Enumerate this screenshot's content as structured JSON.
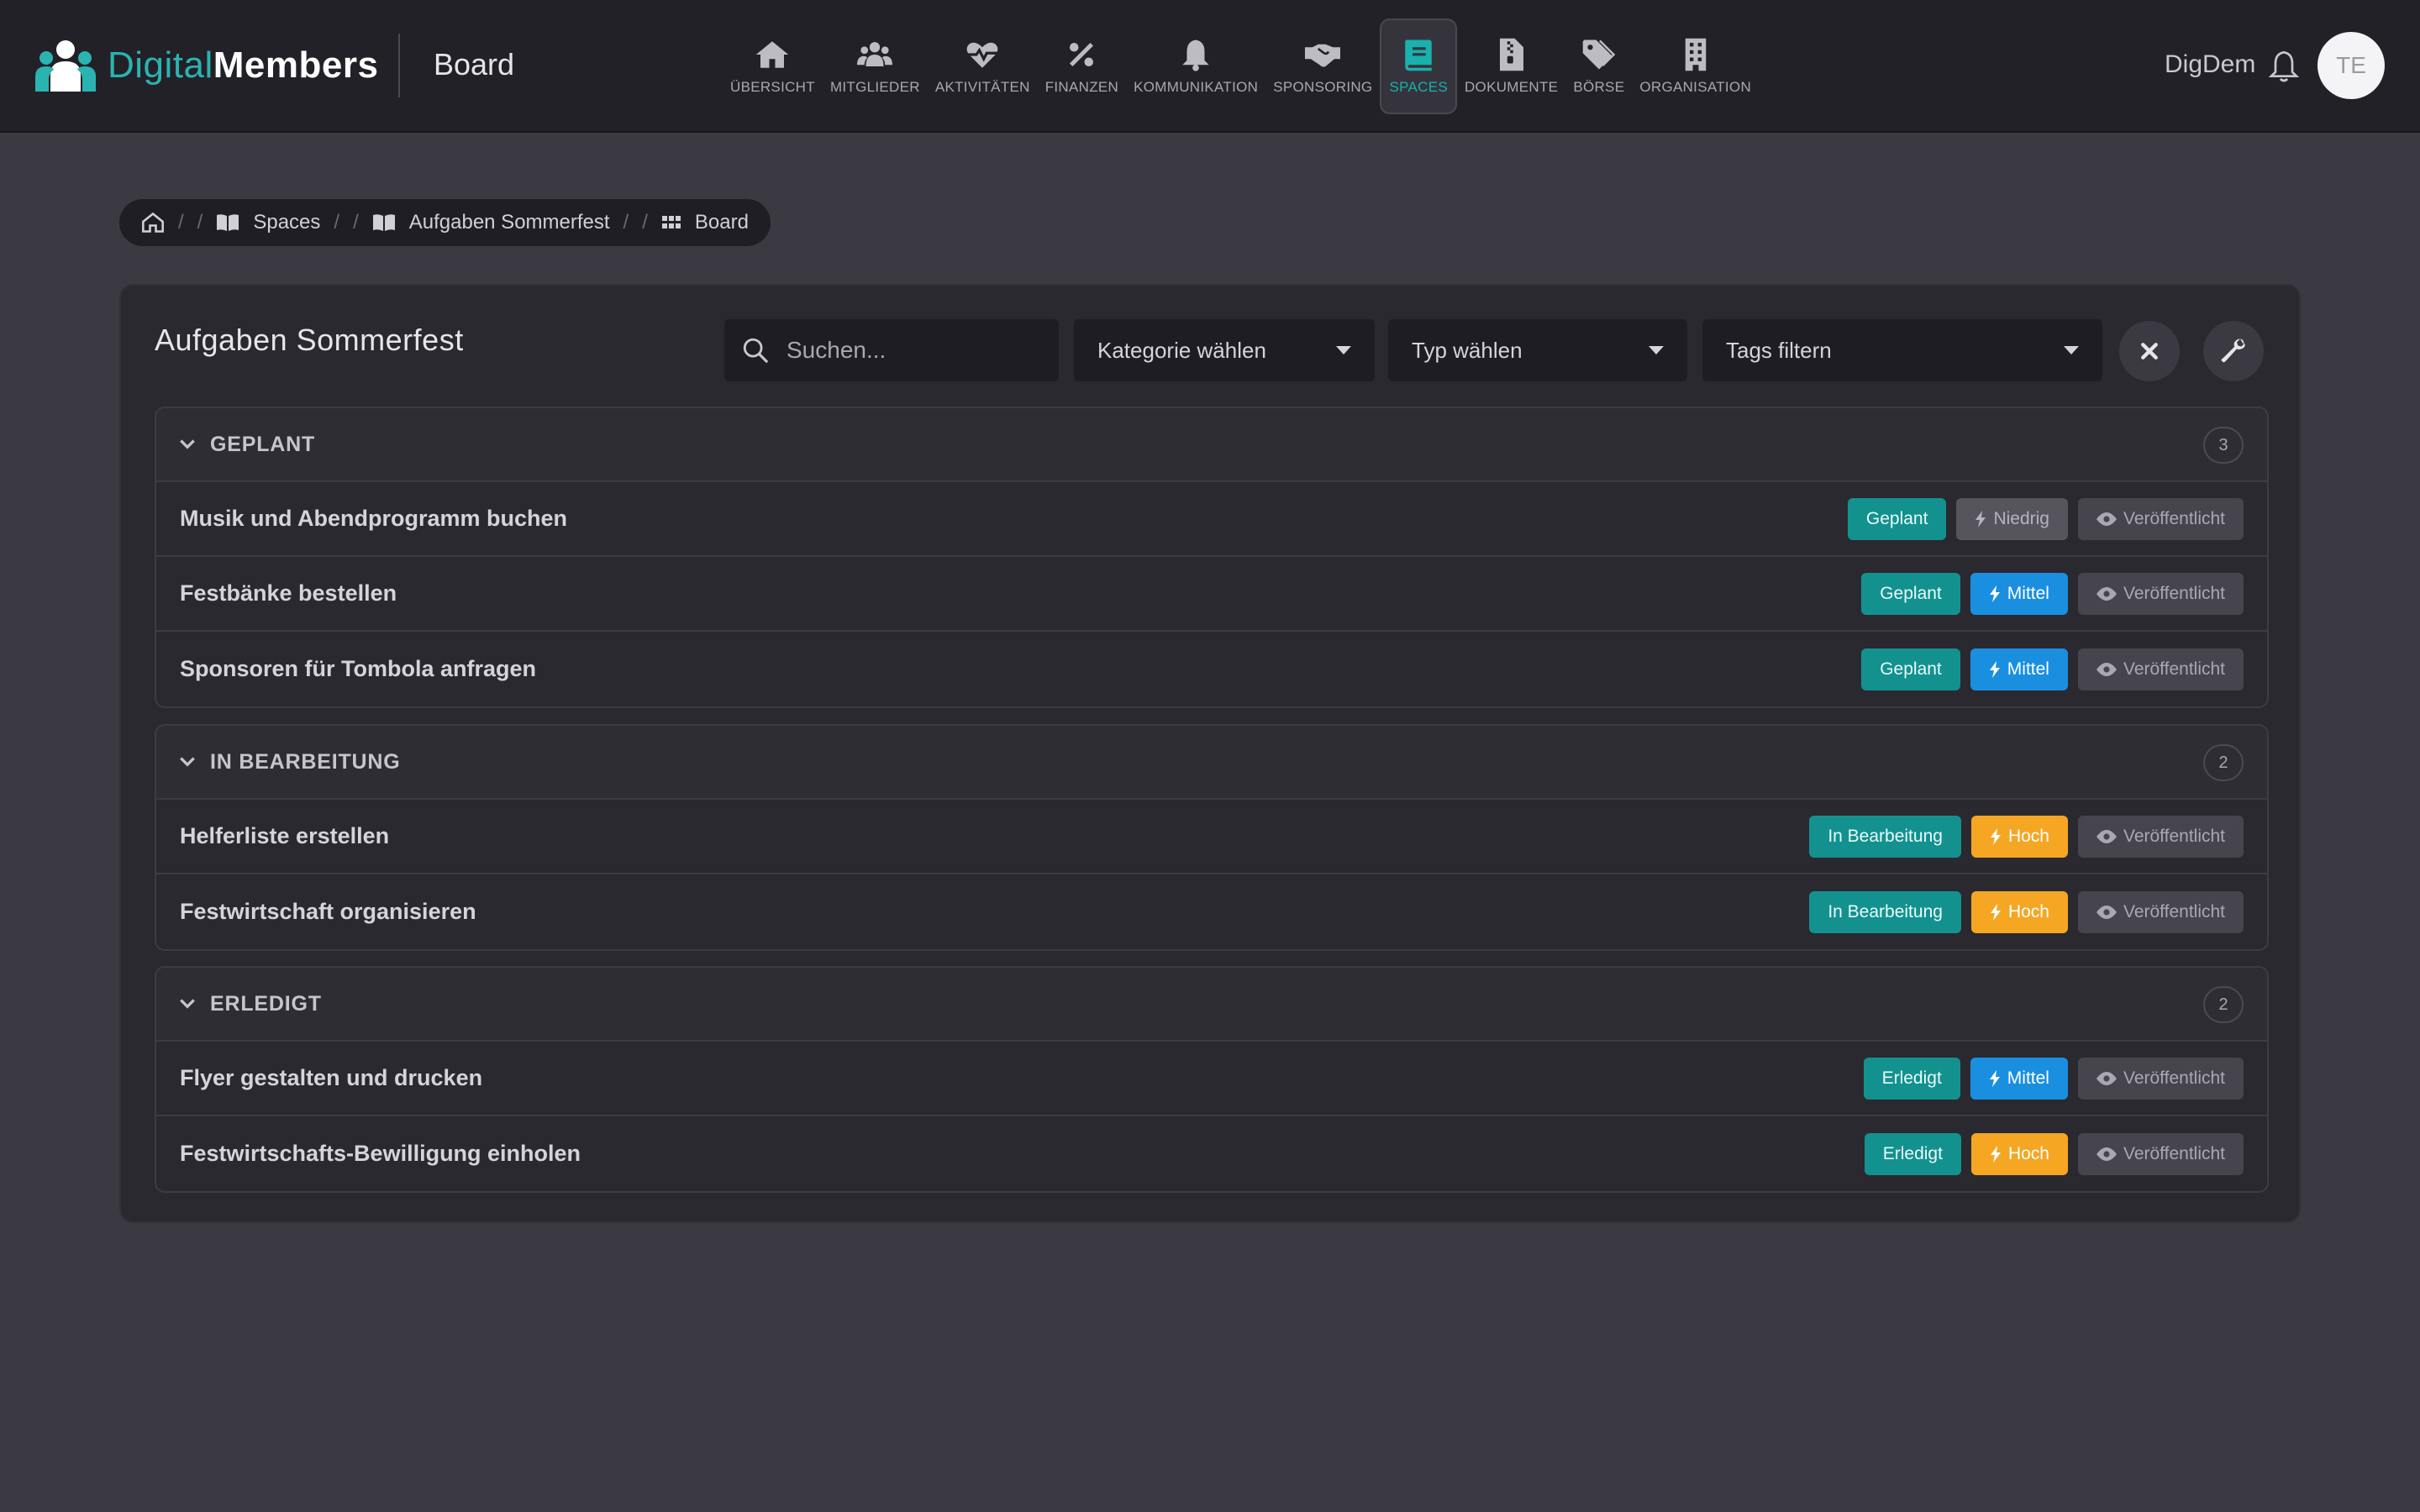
{
  "app": {
    "logo_text_a": "Digital",
    "logo_text_b": "Members",
    "board_title": "Board",
    "user_name": "DigDem",
    "avatar_initials": "TE"
  },
  "nav": [
    {
      "label": "ÜBERSICHT",
      "icon": "home-icon"
    },
    {
      "label": "MITGLIEDER",
      "icon": "users-icon"
    },
    {
      "label": "AKTIVITÄTEN",
      "icon": "heartbeat-icon"
    },
    {
      "label": "FINANZEN",
      "icon": "percent-icon"
    },
    {
      "label": "KOMMUNIKATION",
      "icon": "bell-icon"
    },
    {
      "label": "SPONSORING",
      "icon": "handshake-icon"
    },
    {
      "label": "SPACES",
      "icon": "book-icon",
      "active": true
    },
    {
      "label": "DOKUMENTE",
      "icon": "file-zip-icon"
    },
    {
      "label": "BÖRSE",
      "icon": "tags-icon"
    },
    {
      "label": "ORGANISATION",
      "icon": "building-icon"
    }
  ],
  "breadcrumb": [
    "Spaces",
    "Aufgaben Sommerfest",
    "Board"
  ],
  "page": {
    "title": "Aufgaben Sommerfest",
    "search_placeholder": "Suchen...",
    "category_select": "Kategorie wählen",
    "type_select": "Typ wählen",
    "tags_select": "Tags filtern"
  },
  "groups": [
    {
      "title": "GEPLANT",
      "count": "3",
      "items": [
        {
          "title": "Musik und Abendprogramm buchen",
          "status": "Geplant",
          "priority": "Niedrig",
          "visibility": "Veröffentlicht"
        },
        {
          "title": "Festbänke bestellen",
          "status": "Geplant",
          "priority": "Mittel",
          "visibility": "Veröffentlicht"
        },
        {
          "title": "Sponsoren für Tombola anfragen",
          "status": "Geplant",
          "priority": "Mittel",
          "visibility": "Veröffentlicht"
        }
      ]
    },
    {
      "title": "IN BEARBEITUNG",
      "count": "2",
      "items": [
        {
          "title": "Helferliste erstellen",
          "status": "In Bearbeitung",
          "priority": "Hoch",
          "visibility": "Veröffentlicht"
        },
        {
          "title": "Festwirtschaft organisieren",
          "status": "In Bearbeitung",
          "priority": "Hoch",
          "visibility": "Veröffentlicht"
        }
      ]
    },
    {
      "title": "ERLEDIGT",
      "count": "2",
      "items": [
        {
          "title": "Flyer gestalten und drucken",
          "status": "Erledigt",
          "priority": "Mittel",
          "visibility": "Veröffentlicht"
        },
        {
          "title": "Festwirtschafts-Bewilligung einholen",
          "status": "Erledigt",
          "priority": "Hoch",
          "visibility": "Veröffentlicht"
        }
      ]
    }
  ],
  "colors": {
    "accent": "#19b1ad",
    "status": "#13918f",
    "priority_low": "#56555d",
    "priority_medium": "#1a8fe0",
    "priority_high": "#f5a623"
  }
}
